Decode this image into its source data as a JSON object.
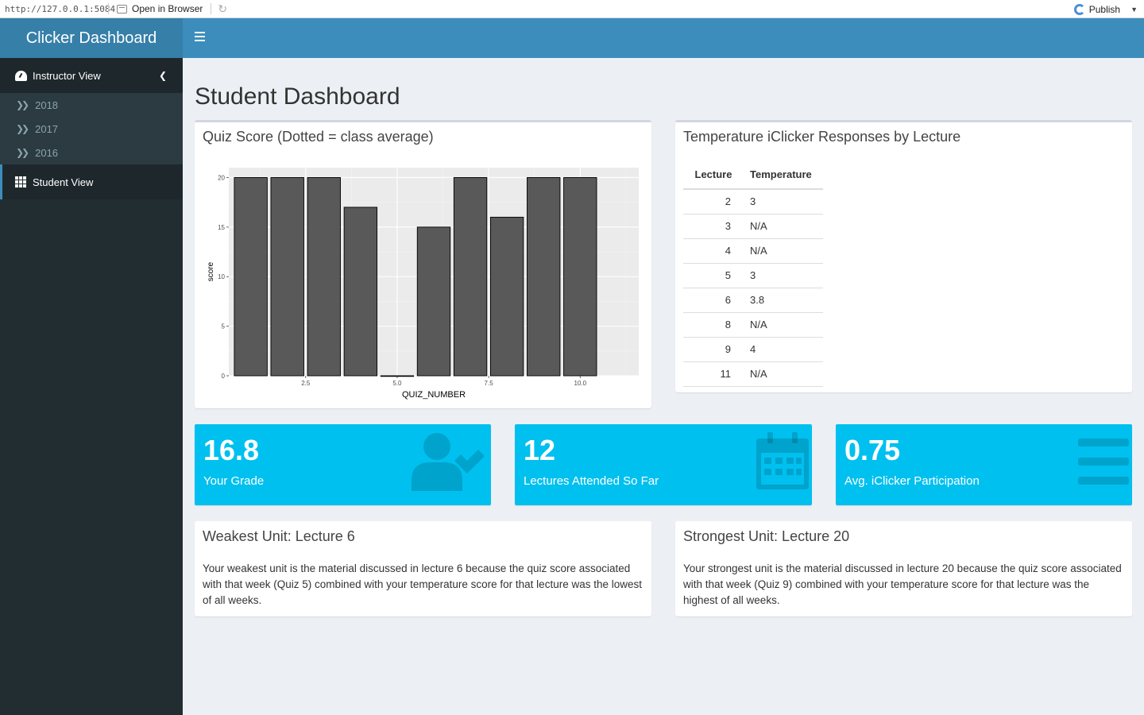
{
  "viewer": {
    "url": "http://127.0.0.1:5084",
    "open_browser": "Open in Browser",
    "publish": "Publish"
  },
  "app": {
    "title": "Clicker Dashboard"
  },
  "sidebar": {
    "instructor_label": "Instructor View",
    "years": [
      "2018",
      "2017",
      "2016"
    ],
    "student_label": "Student View"
  },
  "page": {
    "title": "Student Dashboard"
  },
  "quiz_box": {
    "title": "Quiz Score (Dotted = class average)"
  },
  "chart_data": {
    "type": "bar",
    "x": [
      1,
      2,
      3,
      4,
      5,
      6,
      7,
      8,
      9,
      10
    ],
    "values": [
      20,
      20,
      20,
      17,
      0,
      15,
      20,
      16,
      20,
      20
    ],
    "xlabel": "QUIZ_NUMBER",
    "ylabel": "score",
    "xticks": [
      "2.5",
      "5.0",
      "7.5",
      "10.0"
    ],
    "yticks": [
      "0",
      "5",
      "10",
      "15",
      "20"
    ],
    "xlim": [
      0.4,
      11.6
    ],
    "ylim": [
      0,
      21
    ],
    "grid": true,
    "bar_color": "#595959"
  },
  "temp_box": {
    "title": "Temperature iClicker Responses by Lecture",
    "columns": [
      "Lecture",
      "Temperature"
    ],
    "rows": [
      [
        "2",
        "3"
      ],
      [
        "3",
        "N/A"
      ],
      [
        "4",
        "N/A"
      ],
      [
        "5",
        "3"
      ],
      [
        "6",
        "3.8"
      ],
      [
        "8",
        "N/A"
      ],
      [
        "9",
        "4"
      ],
      [
        "11",
        "N/A"
      ]
    ]
  },
  "value_boxes": [
    {
      "value": "16.8",
      "label": "Your Grade",
      "icon": "user-check-icon"
    },
    {
      "value": "12",
      "label": "Lectures Attended So Far",
      "icon": "calendar-icon"
    },
    {
      "value": "0.75",
      "label": "Avg. iClicker Participation",
      "icon": "bars-icon"
    }
  ],
  "weakest": {
    "title": "Weakest Unit: Lecture 6",
    "text": "Your weakest unit is the material discussed in lecture 6 because the quiz score associated with that week (Quiz 5) combined with your temperature score for that lecture was the lowest of all weeks."
  },
  "strongest": {
    "title": "Strongest Unit: Lecture 20",
    "text": "Your strongest unit is the material discussed in lecture 20 because the quiz score associated with that week (Quiz 9) combined with your temperature score for that lecture was the highest of all weeks."
  },
  "colors": {
    "header": "#3c8dbc",
    "logo": "#367fa9",
    "sidebar": "#222d32",
    "value_box": "#00c0ef",
    "background": "#ecf0f5"
  }
}
